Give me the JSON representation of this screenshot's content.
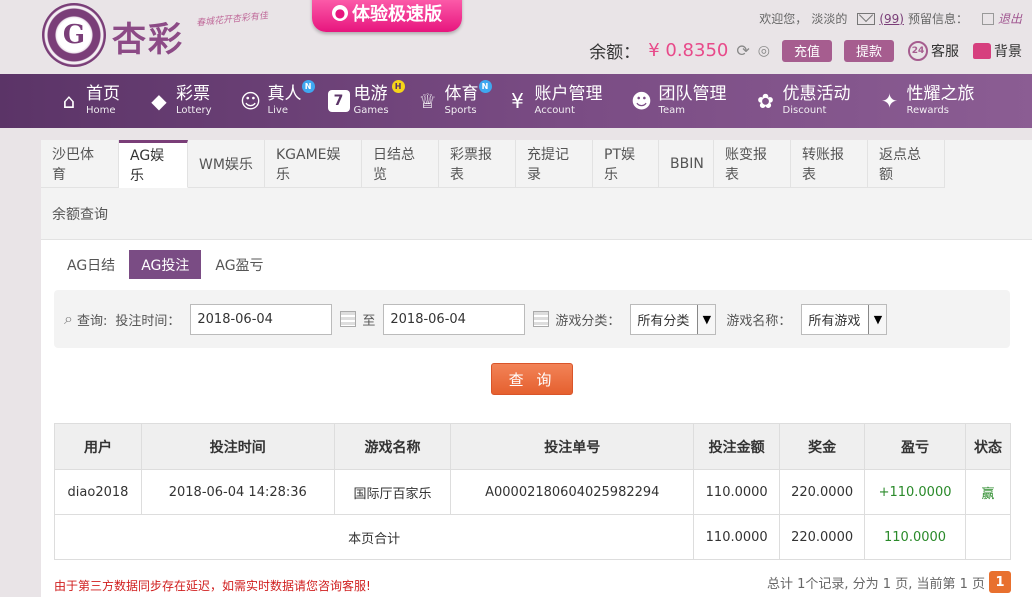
{
  "header": {
    "logo_text": "杏彩",
    "logo_slogan": "春城花开杏彩有佳",
    "promo_label": "体验极速版",
    "welcome": "欢迎您，",
    "username": "淡淡的",
    "unread": "(99)",
    "notice_label": "预留信息：",
    "logout": "退出",
    "balance_label": "余额：",
    "balance_value": "¥ 0.8350",
    "deposit": "充值",
    "withdraw": "提款",
    "service": "客服",
    "background": "背景"
  },
  "nav": [
    {
      "zh": "首页",
      "en": "Home",
      "icon": "home-icon",
      "glyph": "⌂",
      "badge": ""
    },
    {
      "zh": "彩票",
      "en": "Lottery",
      "icon": "lottery-icon",
      "glyph": "◆",
      "badge": ""
    },
    {
      "zh": "真人",
      "en": "Live",
      "icon": "live-icon",
      "glyph": "☺",
      "badge": "N"
    },
    {
      "zh": "电游",
      "en": "Games",
      "icon": "games-icon",
      "glyph": "7",
      "badge": "H"
    },
    {
      "zh": "体育",
      "en": "Sports",
      "icon": "sports-icon",
      "glyph": "♕",
      "badge": "N"
    },
    {
      "zh": "账户管理",
      "en": "Account",
      "icon": "account-icon",
      "glyph": "¥",
      "badge": ""
    },
    {
      "zh": "团队管理",
      "en": "Team",
      "icon": "team-icon",
      "glyph": "☻",
      "badge": ""
    },
    {
      "zh": "优惠活动",
      "en": "Discount",
      "icon": "gift-icon",
      "glyph": "✿",
      "badge": ""
    },
    {
      "zh": "性耀之旅",
      "en": "Rewards",
      "icon": "rewards-icon",
      "glyph": "✦",
      "badge": ""
    }
  ],
  "tabs": [
    "沙巴体育",
    "AG娱乐",
    "WM娱乐",
    "KGAME娱乐",
    "日结总览",
    "彩票报表",
    "充提记录",
    "PT娱乐",
    "BBIN",
    "账变报表",
    "转账报表",
    "返点总额",
    "余额查询"
  ],
  "active_tab": "AG娱乐",
  "subtabs": [
    "AG日结",
    "AG投注",
    "AG盈亏"
  ],
  "active_subtab": "AG投注",
  "query": {
    "label": "查询:",
    "time_label": "投注时间：",
    "date_from": "2018-06-04",
    "to": "至",
    "date_to": "2018-06-04",
    "category_label": "游戏分类：",
    "category_value": "所有分类",
    "name_label": "游戏名称：",
    "name_value": "所有游戏",
    "submit": "查 询"
  },
  "table": {
    "headers": [
      "用户",
      "投注时间",
      "游戏名称",
      "投注单号",
      "投注金额",
      "奖金",
      "盈亏",
      "状态"
    ],
    "rows": [
      [
        "diao2018",
        "2018-06-04 14:28:36",
        "国际厅百家乐",
        "A00002180604025982294",
        "110.0000",
        "220.0000",
        "+110.0000",
        "赢"
      ]
    ],
    "total_label": "本页合计",
    "total_bet": "110.0000",
    "total_prize": "220.0000",
    "total_profit": "110.0000"
  },
  "footer": {
    "note": "由于第三方数据同步存在延迟，如需实时数据请您咨询客服!",
    "summary": "总计 1个记录, 分为 1 页, 当前第 1 页",
    "page": "1"
  }
}
